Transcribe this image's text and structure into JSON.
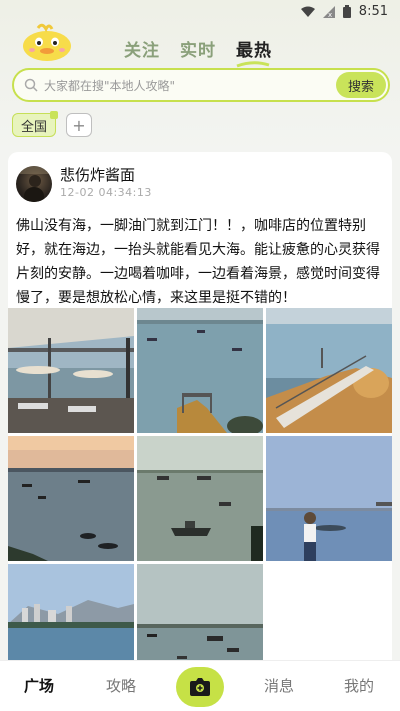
{
  "status_bar": {
    "time": "8:51"
  },
  "top_tabs": [
    {
      "label": "关注"
    },
    {
      "label": "实时"
    },
    {
      "label": "最热"
    }
  ],
  "search": {
    "placeholder": "大家都在搜\"本地人攻略\"",
    "button_label": "搜索"
  },
  "region_filter": {
    "selected": "全国",
    "add_label": "+"
  },
  "post": {
    "author": "悲伤炸酱面",
    "time": "12-02 04:34:13",
    "body": "佛山没有海，一脚油门就到江门！！，咖啡店的位置特别好，就在海边，一抬头就能看见大海。能让疲惫的心灵获得片刻的安静。一边喝着咖啡，一边看着海景，感觉时间变得慢了，要是想放松心情，来这里是挺不错的！",
    "photos": [
      "cafe-terrace-photo",
      "harbor-pier-photo",
      "boardwalk-rocks-photo",
      "sunset-boats-photo",
      "evening-boats-photo",
      "person-seaside-photo",
      "coastal-city-photo",
      "harbor-boats-photo"
    ]
  },
  "bottom_nav": {
    "items": [
      {
        "label": "广场"
      },
      {
        "label": "攻略"
      },
      {
        "label": "消息"
      },
      {
        "label": "我的"
      }
    ],
    "publish_icon": "camera-icon"
  },
  "colors": {
    "accent": "#c9e35a",
    "accent_border": "#c7e04d"
  }
}
